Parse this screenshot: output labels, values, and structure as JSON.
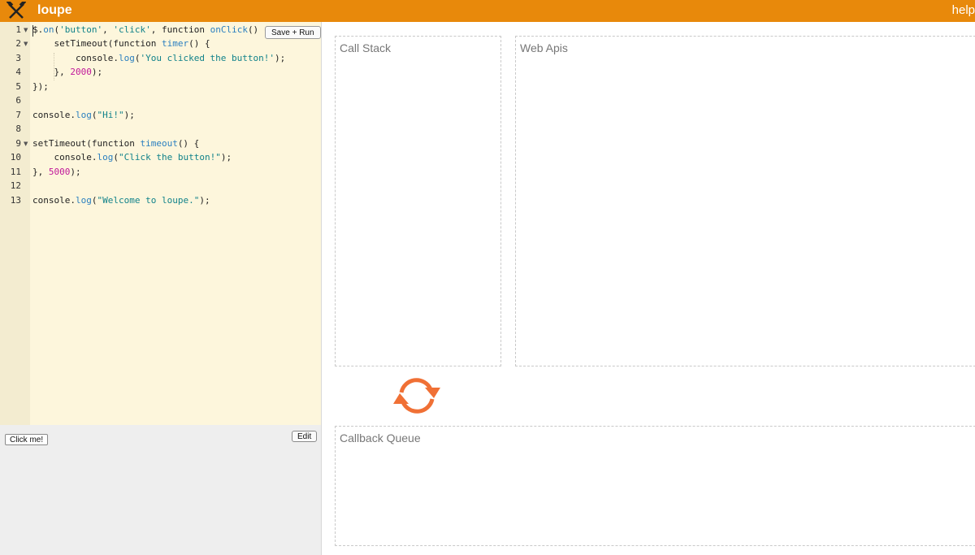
{
  "app": {
    "title": "loupe",
    "help_label": "help",
    "accent_color": "#e8890b",
    "logo_icon": "crossed-hammers-icon"
  },
  "editor": {
    "save_label": "Save + Run",
    "line_numbers": [
      "1",
      "2",
      "3",
      "4",
      "5",
      "6",
      "7",
      "8",
      "9",
      "10",
      "11",
      "12",
      "13"
    ],
    "lines": [
      "$.on('button', 'click', function onClick() {",
      "    setTimeout(function timer() {",
      "        console.log('You clicked the button!');",
      "    }, 2000);",
      "});",
      "",
      "console.log(\"Hi!\");",
      "",
      "setTimeout(function timeout() {",
      "    console.log(\"Click the button!\");",
      "}, 5000);",
      "",
      "console.log(\"Welcome to loupe.\");"
    ]
  },
  "preview": {
    "click_me_label": "Click me!",
    "edit_label": "Edit"
  },
  "panels": {
    "call_stack": "Call Stack",
    "web_apis": "Web Apis",
    "callback_queue": "Callback Queue"
  },
  "event_loop": {
    "icon": "refresh-loop-icon",
    "color": "#f07035"
  }
}
